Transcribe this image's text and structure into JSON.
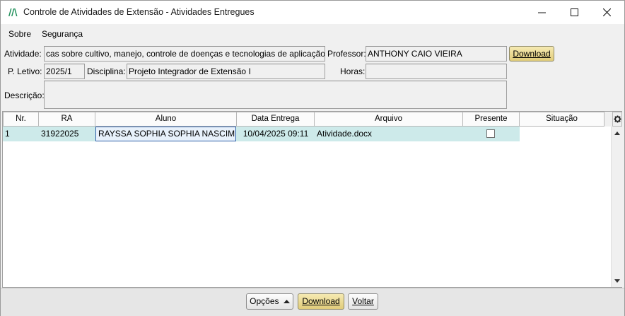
{
  "window": {
    "title": "Controle de Atividades de Extensão - Atividades Entregues"
  },
  "menu": {
    "items": [
      {
        "label": "Sobre"
      },
      {
        "label": "Segurança"
      }
    ]
  },
  "form": {
    "atividade_label": "Atividade:",
    "atividade_value": "cas sobre cultivo, manejo, controle de doenças e tecnologias de aplicação.",
    "professor_label": "Professor:",
    "professor_value": "ANTHONY CAIO VIEIRA",
    "download_label": "Download",
    "periodo_label": "P. Letivo:",
    "periodo_value": "2025/1",
    "disciplina_label": "Disciplina:",
    "disciplina_value": "Projeto Integrador de Extensão I",
    "horas_label": "Horas:",
    "horas_value": "",
    "descricao_label": "Descrição:",
    "descricao_value": ""
  },
  "grid": {
    "columns": [
      "Nr.",
      "RA",
      "Aluno",
      "Data Entrega",
      "Arquivo",
      "Presente",
      "Situação"
    ],
    "rows": [
      {
        "nr": "1",
        "ra": "31922025",
        "aluno": "RAYSSA SOPHIA SOPHIA NASCIME…",
        "data_entrega": "10/04/2025 09:11",
        "arquivo": "Atividade.docx",
        "presente": false,
        "situacao": ""
      }
    ],
    "settings_icon": "gear-icon"
  },
  "footer": {
    "opcoes_label": "Opções",
    "download_label": "Download",
    "voltar_label": "Voltar"
  },
  "colors": {
    "row_highlight": "#cdeaea",
    "gold_button": "#e8d68a",
    "selection_border": "#2d5fa8"
  }
}
